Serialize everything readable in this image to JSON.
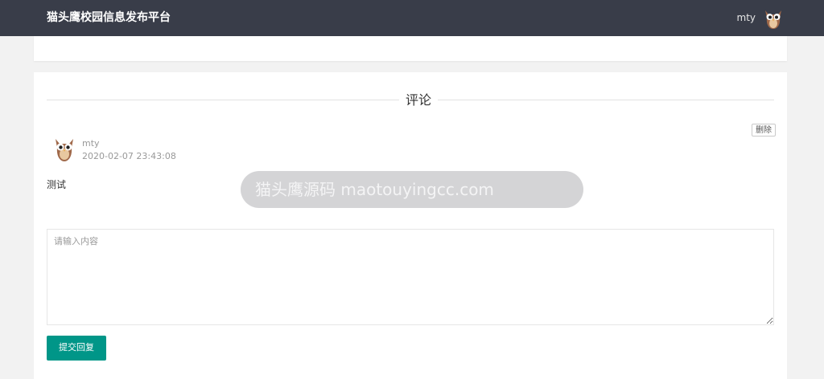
{
  "header": {
    "site_title": "猫头鹰校园信息发布平台",
    "username": "mty",
    "avatar_icon": "owl-avatar-icon",
    "background_color": "#393d49"
  },
  "comments_section": {
    "title": "评论",
    "comments": [
      {
        "author": "mty",
        "timestamp": "2020-02-07 23:43:08",
        "content": "测试",
        "delete_label": "删除",
        "avatar_icon": "owl-avatar-icon"
      }
    ]
  },
  "watermark": {
    "text": "猫头鹰源码 maotouyingcc.com"
  },
  "reply": {
    "placeholder": "请输入内容",
    "value": "",
    "submit_label": "提交回复",
    "submit_color": "#009688"
  }
}
